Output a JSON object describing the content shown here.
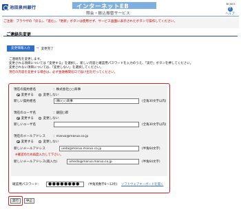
{
  "header": {
    "bank_name": "池田泉州銀行",
    "banner_title": "インターネットEB",
    "banner_subtitle": "照会・振込振替サービス",
    "page_id": "BCJ001",
    "help_label": "ヘルプ",
    "help_icon": "question-icon"
  },
  "notice": "ご注意：ブラウザの「戻る」、「進む」、「更新」ボタンは使用せず、サービス画面に表示されたボタンで操作してください。",
  "section": {
    "title": "ご連絡先変更"
  },
  "steps": {
    "current": "変更情報入力",
    "arrow": "⇒",
    "next": "変更完了"
  },
  "intro": {
    "line1": "ご連絡先を変更します。",
    "line2": "変更される項目については「変更する」を選択し、新しい内容と確認用パスワードを入力のうえ、「実行」ボタンを押してください。",
    "line3": "変更されない項目については、「変更しない」を選択してください。",
    "line4": "現在の内容を変更する場合は、必ず金融機関窓口で届け出を行ってください。"
  },
  "form": {
    "company": {
      "label": "現在の契約者名",
      "value": "：株式会社○○商事",
      "opt_change": "変更する",
      "opt_keep": "変更しない",
      "selected": "change",
      "new_label": "新しい契約者名",
      "new_value": "(株)○○商事",
      "hint": "(全角30文字以内)"
    },
    "user": {
      "label": "現在のユーザ名",
      "value": "：銀田○郎",
      "opt_change": "変更する",
      "opt_keep": "変更しない",
      "selected": "change",
      "new_label": "新しいユーザ名",
      "new_value": "",
      "hint": "(全角30文字以内)"
    },
    "email": {
      "label": "現在のメールアドレス",
      "value": "：maruo@maruo.co.jp",
      "opt_change": "変更する",
      "opt_keep": "変更しない",
      "selected": "change",
      "new_label": "新しいメールアドレス",
      "new_value": "ueda@maruo.maruo.co.jp",
      "hint": "(半角64文字)",
      "warning": "※確認のため再度入力して下さい。",
      "confirm_label": "新しいメールアドレス(再入力)",
      "confirm_value": "umeda@maruo.maruo.co.jp",
      "confirm_hint": "(半角64文字)"
    },
    "password": {
      "label": "確認用パスワード：",
      "value": "●●●●●●●●",
      "hint": "(半角英数字6～12桁)",
      "keyboard_link": "ソフトウェアキーボードを開く"
    }
  },
  "buttons": {
    "execute": "実行",
    "cancel": "中止"
  }
}
